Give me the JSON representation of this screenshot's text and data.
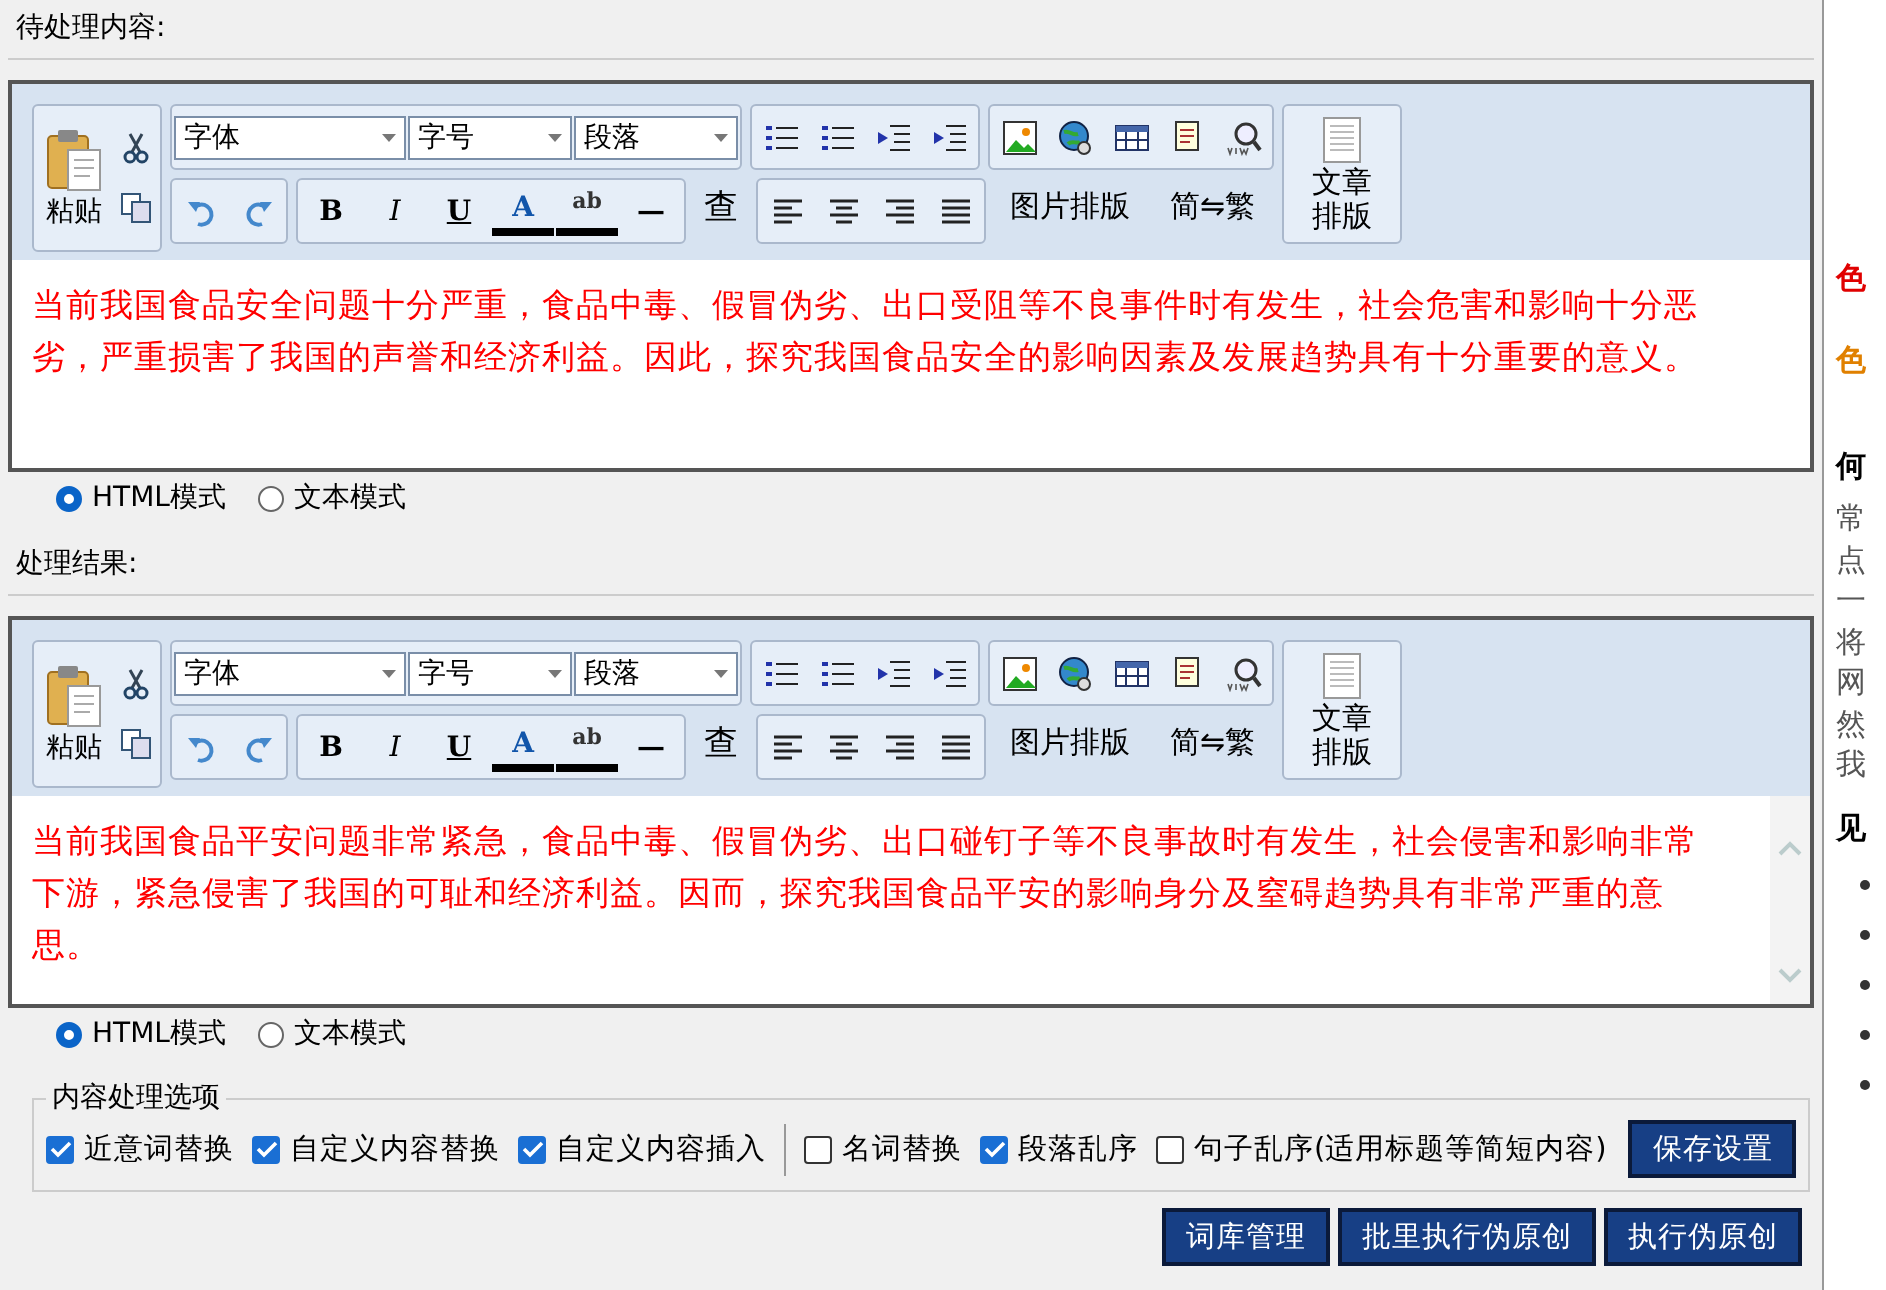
{
  "editors": [
    {
      "label": "待处理内容:",
      "paste": "粘贴",
      "dropdowns": [
        "字体",
        "字号",
        "段落"
      ],
      "format_buttons": [
        "B",
        "I",
        "U",
        "A",
        "ab",
        "—"
      ],
      "find_button": "查",
      "text_buttons": [
        "图片排版",
        "简⇋繁"
      ],
      "layout_button": "文章排版",
      "text": "当前我国食品安全问题十分严重，食品中毒、假冒伪劣、出口受阻等不良事件时有发生，社会危害和影响十分恶劣，严重损害了我国的声誉和经济利益。因此，探究我国食品安全的影响因素及发展趋势具有十分重要的意义。",
      "scrollbar": false,
      "modes": [
        {
          "label": "HTML模式",
          "selected": true
        },
        {
          "label": "文本模式",
          "selected": false
        }
      ]
    },
    {
      "label": "处理结果:",
      "paste": "粘贴",
      "dropdowns": [
        "字体",
        "字号",
        "段落"
      ],
      "format_buttons": [
        "B",
        "I",
        "U",
        "A",
        "ab",
        "—"
      ],
      "find_button": "查",
      "text_buttons": [
        "图片排版",
        "简⇋繁"
      ],
      "layout_button": "文章排版",
      "text": "当前我国食品平安问题非常紧急，食品中毒、假冒伪劣、出口碰钉子等不良事故时有发生，社会侵害和影响非常下游，紧急侵害了我国的可耻和经济利益。因而，探究我国食品平安的影响身分及窒碍趋势具有非常严重的意思。",
      "scrollbar": true,
      "modes": [
        {
          "label": "HTML模式",
          "selected": true
        },
        {
          "label": "文本模式",
          "selected": false
        }
      ]
    }
  ],
  "options": {
    "title": "内容处理选项",
    "checkboxes": [
      {
        "label": "近意词替换",
        "checked": true,
        "separator_after": false
      },
      {
        "label": "自定义内容替换",
        "checked": true,
        "separator_after": false
      },
      {
        "label": "自定义内容插入",
        "checked": true,
        "separator_after": true
      },
      {
        "label": "名词替换",
        "checked": false,
        "separator_after": false
      },
      {
        "label": "段落乱序",
        "checked": true,
        "separator_after": false
      },
      {
        "label": "句子乱序(适用标题等简短内容)",
        "checked": false,
        "separator_after": false
      }
    ],
    "save_button": "保存设置"
  },
  "actions": [
    "词库管理",
    "批里执行伪原创",
    "执行伪原创"
  ],
  "side_panel": {
    "marks": [
      {
        "text": "色",
        "color": "#e00000"
      },
      {
        "text": "色",
        "color": "#e08000"
      }
    ],
    "heading": "何",
    "lines": [
      "常",
      "点",
      "一",
      "将",
      "网",
      "然",
      "我"
    ],
    "subheading": "见"
  }
}
